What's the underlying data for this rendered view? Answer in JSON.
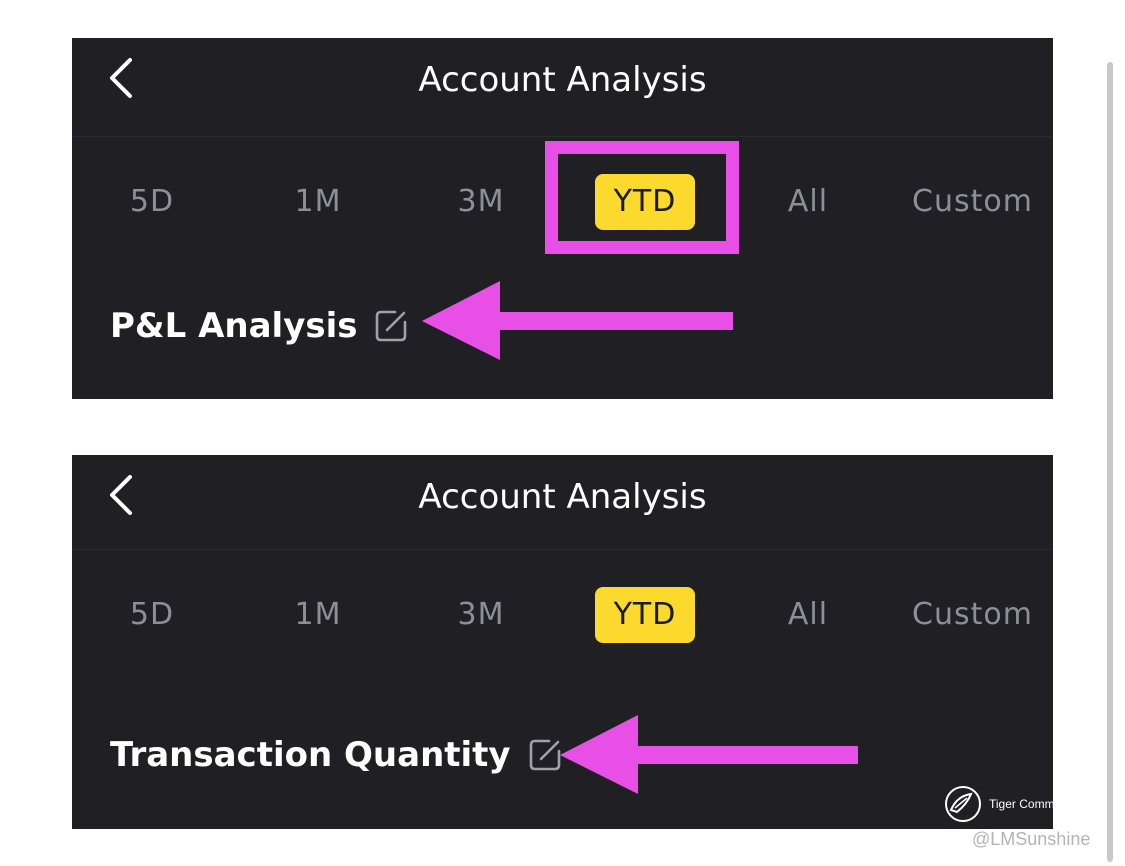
{
  "panels": [
    {
      "header": {
        "back_icon": "chevron-left-icon",
        "title": "Account Analysis"
      },
      "tabs": [
        "5D",
        "1M",
        "3M",
        "YTD",
        "All",
        "Custom"
      ],
      "active_tab": "YTD",
      "section": {
        "title": "P&L Analysis",
        "edit_icon": "edit-icon"
      }
    },
    {
      "header": {
        "back_icon": "chevron-left-icon",
        "title": "Account Analysis"
      },
      "tabs": [
        "5D",
        "1M",
        "3M",
        "YTD",
        "All",
        "Custom"
      ],
      "active_tab": "YTD",
      "section": {
        "title": "Transaction Quantity",
        "edit_icon": "edit-icon"
      }
    }
  ],
  "annotations": {
    "color": "#e84fe6"
  },
  "colors": {
    "background": "#1f1f24",
    "accent": "#fbd92d",
    "tab_inactive": "#8e8e96"
  },
  "watermark": {
    "brand": "Tiger Community",
    "user": "@LMSunshine"
  }
}
